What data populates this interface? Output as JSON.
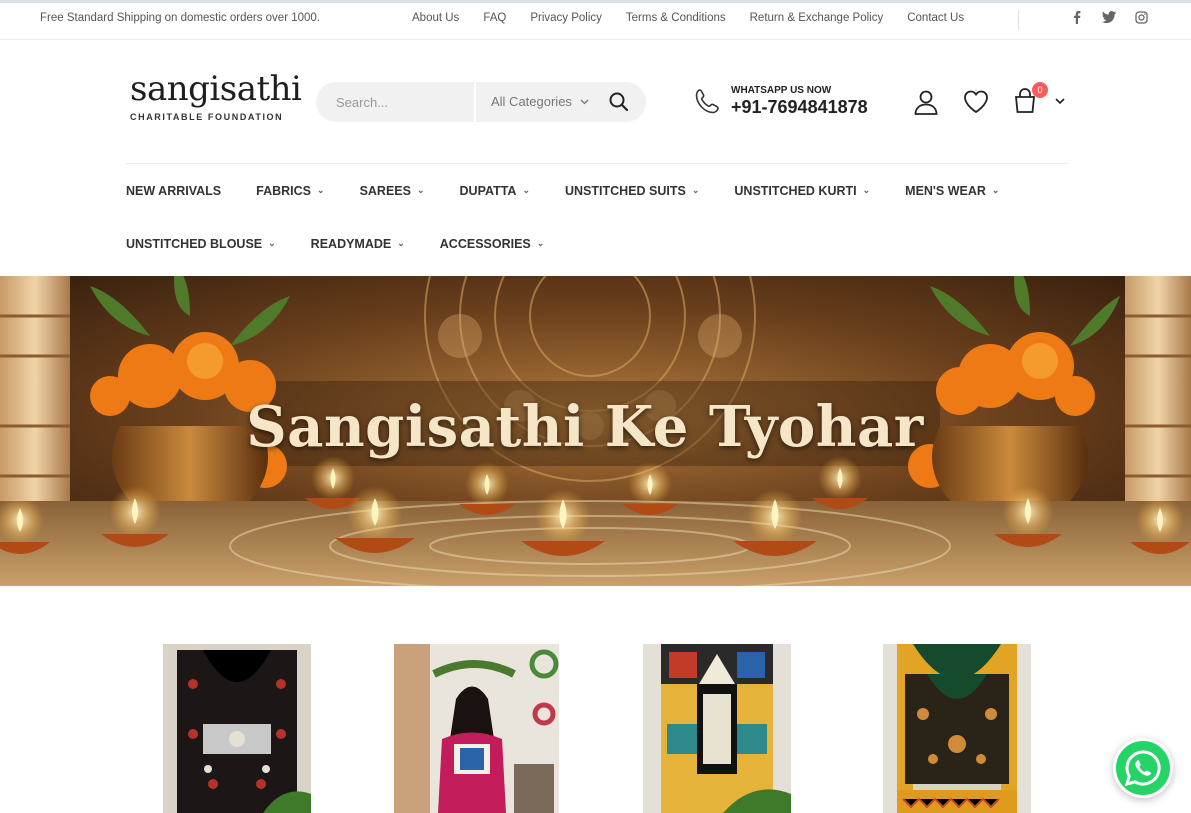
{
  "topbar": {
    "shipping": "Free Standard Shipping on domestic orders over 1000.",
    "links": [
      "About Us",
      "FAQ",
      "Privacy Policy",
      "Terms & Conditions",
      "Return & Exchange Policy",
      "Contact Us"
    ],
    "social": [
      "facebook-icon",
      "twitter-icon",
      "instagram-icon"
    ]
  },
  "header": {
    "logo_main": "sangisathi",
    "logo_sub": "CHARITABLE FOUNDATION",
    "search_placeholder": "Search...",
    "category": "All Categories",
    "whatsapp_label": "WHATSAPP US NOW",
    "phone": "+91-7694841878",
    "cart_count": "0"
  },
  "nav": {
    "row1": [
      "NEW ARRIVALS",
      "FABRICS",
      "SAREES",
      "DUPATTA",
      "UNSTITCHED SUITS",
      "UNSTITCHED KURTI",
      "MEN'S WEAR"
    ],
    "row2": [
      "UNSTITCHED BLOUSE",
      "READYMADE",
      "ACCESSORIES"
    ]
  },
  "banner": {
    "title": "Sangisathi Ke Tyohar"
  },
  "colors": {
    "accent": "#b3201f",
    "badge": "#ff5b5b",
    "whatsapp": "#25d366"
  }
}
